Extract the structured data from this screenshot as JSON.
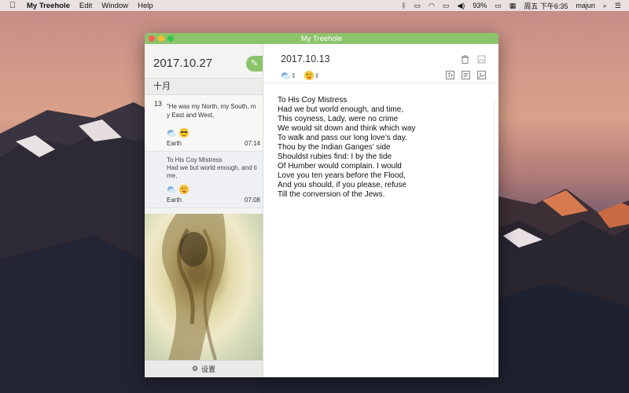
{
  "menubar": {
    "app_name": "My Treehole",
    "menus": [
      "Edit",
      "Window",
      "Help"
    ],
    "battery": "93%",
    "datetime": "周五 下午6:35",
    "user": "majun"
  },
  "window": {
    "title": "My Treehole"
  },
  "sidebar": {
    "current_date": "2017.10.27",
    "month_label": "十月",
    "entries": [
      {
        "day": "13",
        "preview_lines": [
          "“He was my North, my South, m",
          "y East and West,"
        ],
        "location": "Earth",
        "time": "07:14"
      },
      {
        "day": "",
        "preview_lines": [
          "To His Coy Mistress",
          "Had we but world enough, and ti",
          "me,"
        ],
        "location": "Earth",
        "time": "07:08"
      }
    ],
    "settings_label": "设置"
  },
  "main": {
    "date": "2017.10.13",
    "lines": [
      "To His Coy Mistress",
      "Had we but world enough, and time,",
      "This coyness, Lady, were no crime",
      "We would sit down and think which way",
      "To walk and pass our long love’s day.",
      "Thou by the Indian Ganges’ side",
      "Shouldst rubies find: I by the tide",
      "Of Humber would complain. I would",
      "Love you ten years before the Flood,",
      "And you should, if you please, refuse",
      "Till the conversion of the Jews."
    ]
  },
  "colors": {
    "accent": "#8cc46c"
  }
}
